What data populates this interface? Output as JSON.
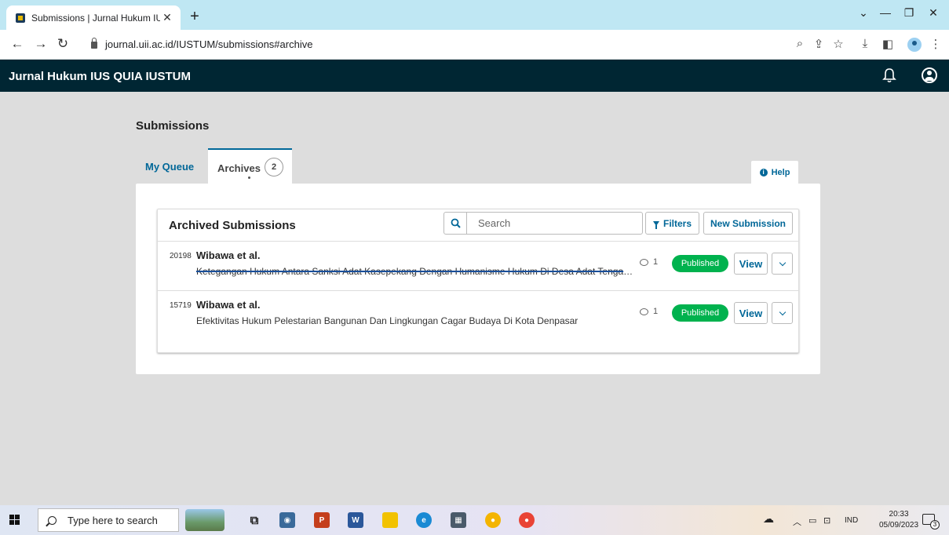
{
  "browser": {
    "tab_title": "Submissions | Jurnal Hukum IUS QUIA IUSTUM",
    "url": "journal.uii.ac.id/IUSTUM/submissions#archive"
  },
  "app": {
    "brand": "Jurnal Hukum IUS QUIA IUSTUM"
  },
  "page": {
    "title": "Submissions",
    "tabs": [
      {
        "label": "My Queue"
      },
      {
        "label": "Archives",
        "count": "2"
      }
    ],
    "help_label": "Help"
  },
  "list": {
    "title": "Archived Submissions",
    "search_placeholder": "Search",
    "filters_label": "Filters",
    "new_submission_label": "New Submission",
    "items": [
      {
        "id": "20198",
        "authors": "Wibawa et al.",
        "title": "Ketegangan Hukum Antara Sanksi Adat Kasepekang Dengan Humanisme Hukum Di Desa Adat Tenganan Pegringsingan",
        "discussions": "1",
        "status": "Published",
        "view_label": "View"
      },
      {
        "id": "15719",
        "authors": "Wibawa et al.",
        "title": "Efektivitas Hukum Pelestarian Bangunan Dan Lingkungan Cagar Budaya Di Kota Denpasar",
        "discussions": "1",
        "status": "Published",
        "view_label": "View"
      }
    ]
  },
  "taskbar": {
    "search_placeholder": "Type here to search",
    "language": "IND",
    "time": "20:33",
    "date": "05/09/2023",
    "notifications": "3"
  },
  "colors": {
    "header_bg": "#002633",
    "link_blue": "#006798",
    "published_green": "#00b24e"
  }
}
